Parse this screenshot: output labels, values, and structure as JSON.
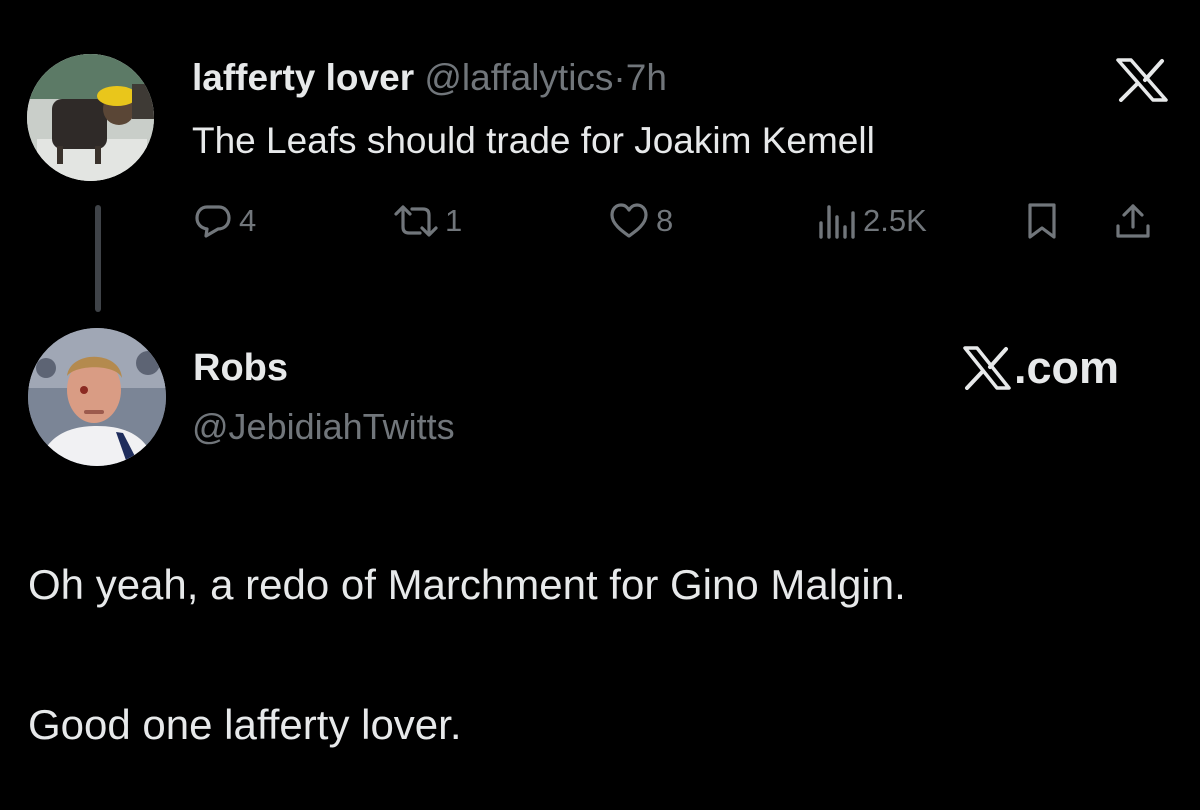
{
  "parent_tweet": {
    "display_name": "lafferty lover",
    "handle": "@laffalytics",
    "separator": "·",
    "time": "7h",
    "text": "The Leafs should trade for Joakim Kemell",
    "metrics": {
      "replies": "4",
      "reposts": "1",
      "likes": "8",
      "views": "2.5K"
    },
    "icons": [
      "x-logo-icon",
      "reply-icon",
      "repost-icon",
      "like-icon",
      "views-icon",
      "bookmark-icon",
      "share-icon"
    ]
  },
  "reply_tweet": {
    "display_name": "Robs",
    "handle": "@JebidiahTwitts",
    "brand_suffix": ".com",
    "paragraphs": [
      "Oh yeah, a redo of Marchment for Gino Malgin.",
      "Good one lafferty lover."
    ]
  },
  "colors": {
    "background": "#000000",
    "text_primary": "#e7e9ea",
    "text_secondary": "#71767b",
    "thread_line": "#3f4348"
  }
}
